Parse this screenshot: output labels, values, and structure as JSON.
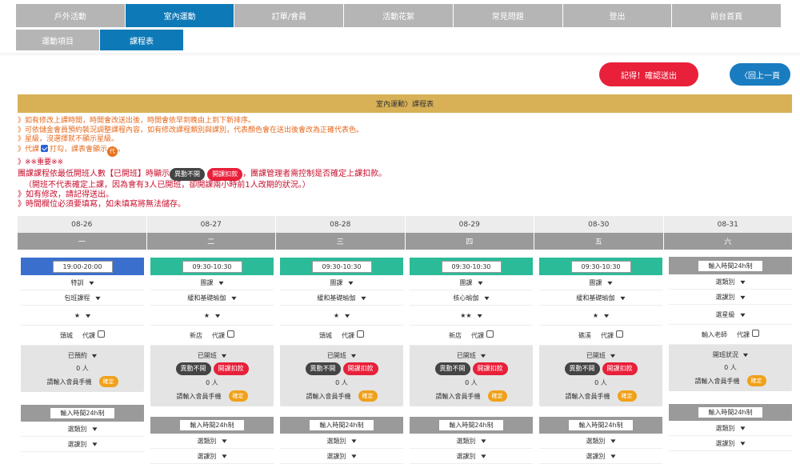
{
  "nav_main": [
    {
      "label": "戶外活動",
      "active": false
    },
    {
      "label": "室內運動",
      "active": true
    },
    {
      "label": "訂單/會員",
      "active": false
    },
    {
      "label": "活動花絮",
      "active": false
    },
    {
      "label": "常見問題",
      "active": false
    },
    {
      "label": "登出",
      "active": false
    },
    {
      "label": "前台首頁",
      "active": false
    }
  ],
  "nav_sub": [
    {
      "label": "運動項目",
      "active": false
    },
    {
      "label": "課程表",
      "active": true
    }
  ],
  "buttons": {
    "confirm": "記得！確認送出",
    "back": "〈回上一頁"
  },
  "banner": "室內運動〉課程表",
  "notes": {
    "n1": "》如有修改上課時間，時間會改送出後，時間會依早到晚由上到下新排序。",
    "n2": "》可依儲金會員預約裝況調整課程內容，如有修改課程類別與課別，代表顏色會在送出後會改為正確代表色。",
    "n3": "》星級，沒選擇就不顯示星級。",
    "n4a": "》代課",
    "n4b": "打勾，課表會顯示",
    "n4c": "代",
    "n4d": "。",
    "n5": "》※※重要※※",
    "n6a": "團課課程依最低開班人數【已開班】時顯示",
    "n6b": "異動不開",
    "n6c": "開課扣款",
    "n6d": "，團課管理者需控制是否確定上課扣款。",
    "n7": "（開班不代表確定上課，因為會有3人已開班，卻開課兩小時前1人改期的狀況。）",
    "n8": "》如有修改，請記得送出。",
    "n9": "》時間欄位必須要填寫，如未填寫將無法儲存。"
  },
  "days": [
    {
      "date": "08-26",
      "weekday": "一"
    },
    {
      "date": "08-27",
      "weekday": "二"
    },
    {
      "date": "08-28",
      "weekday": "三"
    },
    {
      "date": "08-29",
      "weekday": "四"
    },
    {
      "date": "08-30",
      "weekday": "五"
    },
    {
      "date": "08-31",
      "weekday": "六"
    }
  ],
  "cards": [
    {
      "time": "19:00-20:00",
      "color": "#3a6fce",
      "type": "特訓",
      "course": "包班課程",
      "star": "★",
      "location": "頭城",
      "sub": "代課",
      "status": "已預約",
      "count": "0 人",
      "member": "請輸入會員手機",
      "confirm": "確定",
      "pills": false
    },
    {
      "time": "09:30-10:30",
      "color": "#2cbb98",
      "type": "團課",
      "course": "緩和基礎瑜伽",
      "star": "★",
      "location": "新店",
      "sub": "代課",
      "status": "已開班",
      "count": "0 人",
      "member": "請輸入會員手機",
      "confirm": "確定",
      "pills": true,
      "p1": "異動不開",
      "p2": "開課扣款"
    },
    {
      "time": "09:30-10:30",
      "color": "#2cbb98",
      "type": "團課",
      "course": "緩和基礎瑜伽",
      "star": "★",
      "location": "頭城",
      "sub": "代課",
      "status": "已開班",
      "count": "0 人",
      "member": "請輸入會員手機",
      "confirm": "確定",
      "pills": true,
      "p1": "異動不開",
      "p2": "開課扣款"
    },
    {
      "time": "09:30-10:30",
      "color": "#2cbb98",
      "type": "團課",
      "course": "核心瑜伽",
      "star": "★★",
      "location": "新店",
      "sub": "代課",
      "status": "已開班",
      "count": "0 人",
      "member": "請輸入會員手機",
      "confirm": "確定",
      "pills": true,
      "p1": "異動不開",
      "p2": "開課扣款"
    },
    {
      "time": "09:30-10:30",
      "color": "#2cbb98",
      "type": "團課",
      "course": "緩和基礎瑜伽",
      "star": "★",
      "location": "礁溪",
      "sub": "代課",
      "status": "已開班",
      "count": "0 人",
      "member": "請輸入會員手機",
      "confirm": "確定",
      "pills": true,
      "p1": "異動不開",
      "p2": "開課扣款"
    },
    {
      "time": "輸入時間24h制",
      "color": "#9a9a9a",
      "type": "選類別",
      "course": "選課別",
      "star": "選星級",
      "location": "輸入老師",
      "sub": "代課",
      "status": "開班狀況",
      "count": "0 人",
      "member": "請輸入會員手機",
      "confirm": "確定",
      "pills": false
    }
  ],
  "empty_card": {
    "time": "輸入時間24h制",
    "type": "選類別",
    "course": "選課別"
  }
}
